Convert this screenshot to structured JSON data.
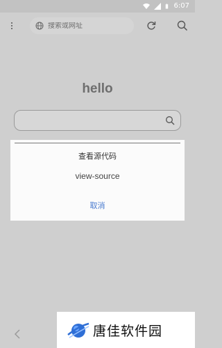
{
  "status_bar": {
    "time": "6:07",
    "icons": [
      "wifi-icon",
      "signal-icon",
      "battery-icon"
    ]
  },
  "toolbar": {
    "menu_icon": "more-vert-icon",
    "url_placeholder": "搜索或网址",
    "url_value": "",
    "url_icon": "globe-icon",
    "refresh_icon": "refresh-icon",
    "search_icon": "search-icon"
  },
  "home": {
    "logo_text": "hello",
    "search_value": "",
    "search_icon": "search-icon"
  },
  "dialog": {
    "options": [
      "查看源代码",
      "view-source"
    ],
    "cancel_label": "取消",
    "cancel_color": "#4a7bd0"
  },
  "bottom_bar": {
    "back_icon": "chevron-left-icon"
  },
  "watermark": {
    "text": "唐佳软件园",
    "logo": "planet-logo",
    "logo_color": "#2f6fd6"
  }
}
